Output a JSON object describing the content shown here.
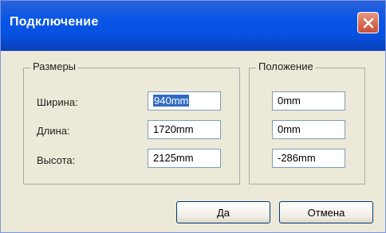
{
  "window": {
    "title": "Подключение"
  },
  "sizes": {
    "legend": "Размеры",
    "width_label": "Ширина:",
    "length_label": "Длина:",
    "height_label": "Высота:",
    "width_value": "940mm",
    "length_value": "1720mm",
    "height_value": "2125mm"
  },
  "position": {
    "legend": "Положение",
    "x_value": "0mm",
    "y_value": "0mm",
    "z_value": "-286mm"
  },
  "buttons": {
    "ok": "Да",
    "cancel": "Отмена"
  },
  "colors": {
    "title_bar": "#0a56e6",
    "close_button": "#d86f52",
    "dialog_bg": "#ece9d8",
    "selection": "#316ac5"
  },
  "icons": {
    "close": "close-icon"
  }
}
